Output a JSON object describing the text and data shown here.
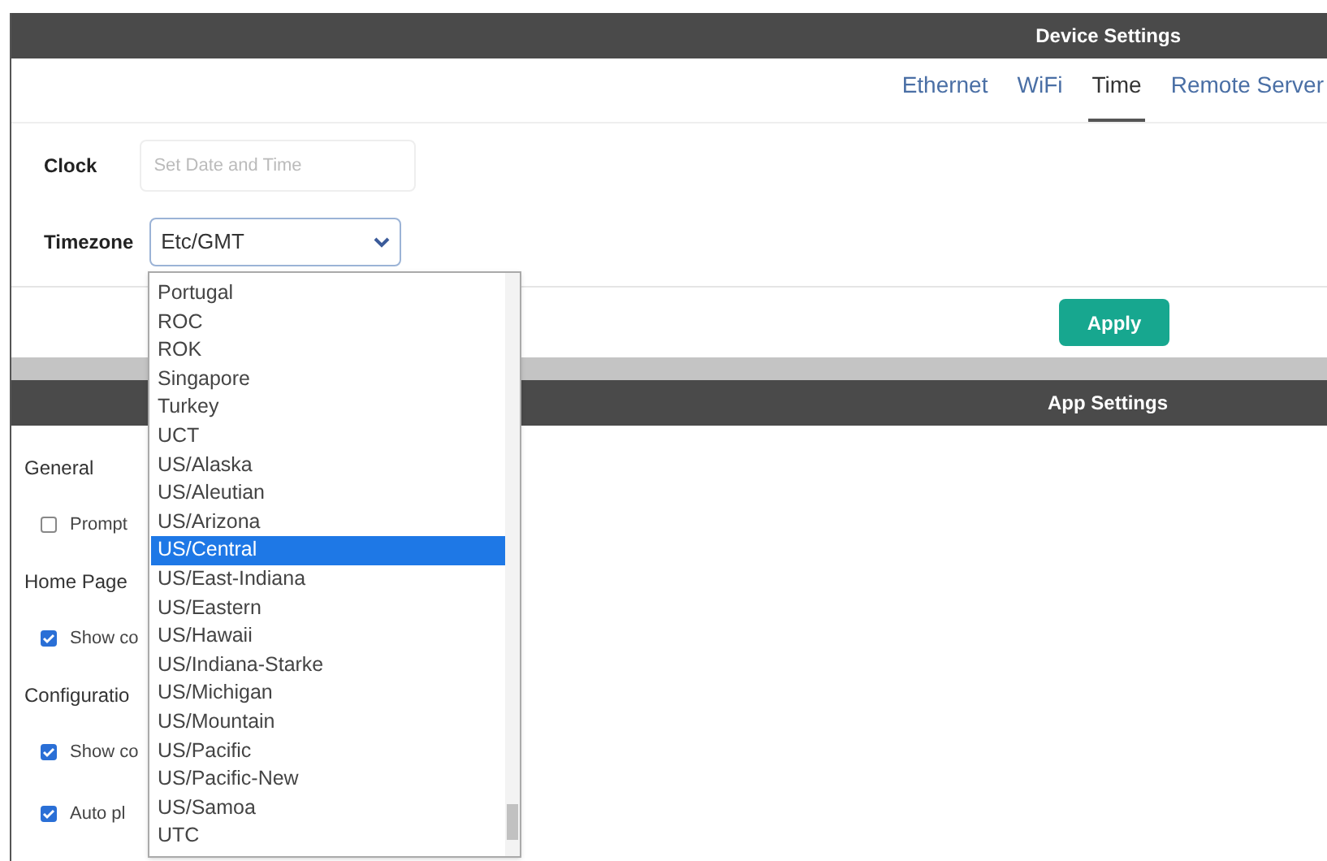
{
  "device_settings": {
    "title": "Device Settings",
    "tabs": [
      {
        "label": "Ethernet",
        "selected": false
      },
      {
        "label": "WiFi",
        "selected": false
      },
      {
        "label": "Time",
        "selected": true
      },
      {
        "label": "Remote Server",
        "selected": false
      }
    ],
    "clock": {
      "label": "Clock",
      "placeholder": "Set Date and Time"
    },
    "timezone": {
      "label": "Timezone",
      "value": "Etc/GMT",
      "options": [
        {
          "label": "Portugal",
          "selected": false
        },
        {
          "label": "ROC",
          "selected": false
        },
        {
          "label": "ROK",
          "selected": false
        },
        {
          "label": "Singapore",
          "selected": false
        },
        {
          "label": "Turkey",
          "selected": false
        },
        {
          "label": "UCT",
          "selected": false
        },
        {
          "label": "US/Alaska",
          "selected": false
        },
        {
          "label": "US/Aleutian",
          "selected": false
        },
        {
          "label": "US/Arizona",
          "selected": false
        },
        {
          "label": "US/Central",
          "selected": true
        },
        {
          "label": "US/East-Indiana",
          "selected": false
        },
        {
          "label": "US/Eastern",
          "selected": false
        },
        {
          "label": "US/Hawaii",
          "selected": false
        },
        {
          "label": "US/Indiana-Starke",
          "selected": false
        },
        {
          "label": "US/Michigan",
          "selected": false
        },
        {
          "label": "US/Mountain",
          "selected": false
        },
        {
          "label": "US/Pacific",
          "selected": false
        },
        {
          "label": "US/Pacific-New",
          "selected": false
        },
        {
          "label": "US/Samoa",
          "selected": false
        },
        {
          "label": "UTC",
          "selected": false
        }
      ]
    },
    "apply_button": "Apply"
  },
  "app_settings": {
    "title": "App Settings",
    "items": [
      {
        "kind": "heading",
        "label": "General"
      },
      {
        "kind": "checkbox",
        "label": "Prompt",
        "checked": false
      },
      {
        "kind": "heading",
        "label": "Home Page"
      },
      {
        "kind": "checkbox",
        "label": "Show co",
        "checked": true
      },
      {
        "kind": "heading",
        "label": "Configuratio"
      },
      {
        "kind": "checkbox",
        "label": "Show co",
        "checked": true
      },
      {
        "kind": "checkbox",
        "label": "Auto pl",
        "checked": true
      }
    ]
  }
}
